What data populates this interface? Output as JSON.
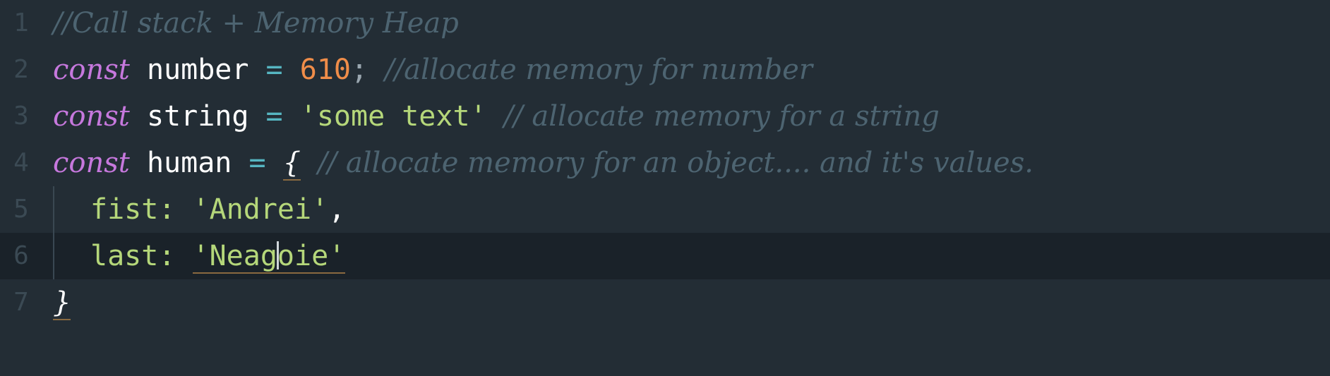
{
  "editor": {
    "lines": [
      {
        "number": "1",
        "comment": "//Call stack + Memory Heap"
      },
      {
        "number": "2",
        "keyword": "const",
        "ident": "number",
        "op": "=",
        "value": "610",
        "semi": ";",
        "comment": "//allocate memory for number"
      },
      {
        "number": "3",
        "keyword": "const",
        "ident": "string",
        "op": "=",
        "value": "'some text'",
        "comment": "// allocate memory for a string"
      },
      {
        "number": "4",
        "keyword": "const",
        "ident": "human",
        "op": "=",
        "brace": "{",
        "comment": "// allocate memory for an object.... and it's values."
      },
      {
        "number": "5",
        "key": "fist:",
        "value": "'Andrei'",
        "punc": ","
      },
      {
        "number": "6",
        "key": "last:",
        "value": "'Neagoie'"
      },
      {
        "number": "7",
        "brace": "}"
      }
    ]
  },
  "colors": {
    "background": "#232d35",
    "active_line": "#1a2229",
    "keyword": "#c678dd",
    "number": "#f08d49",
    "string": "#b5d77a",
    "comment": "#4d6471"
  }
}
